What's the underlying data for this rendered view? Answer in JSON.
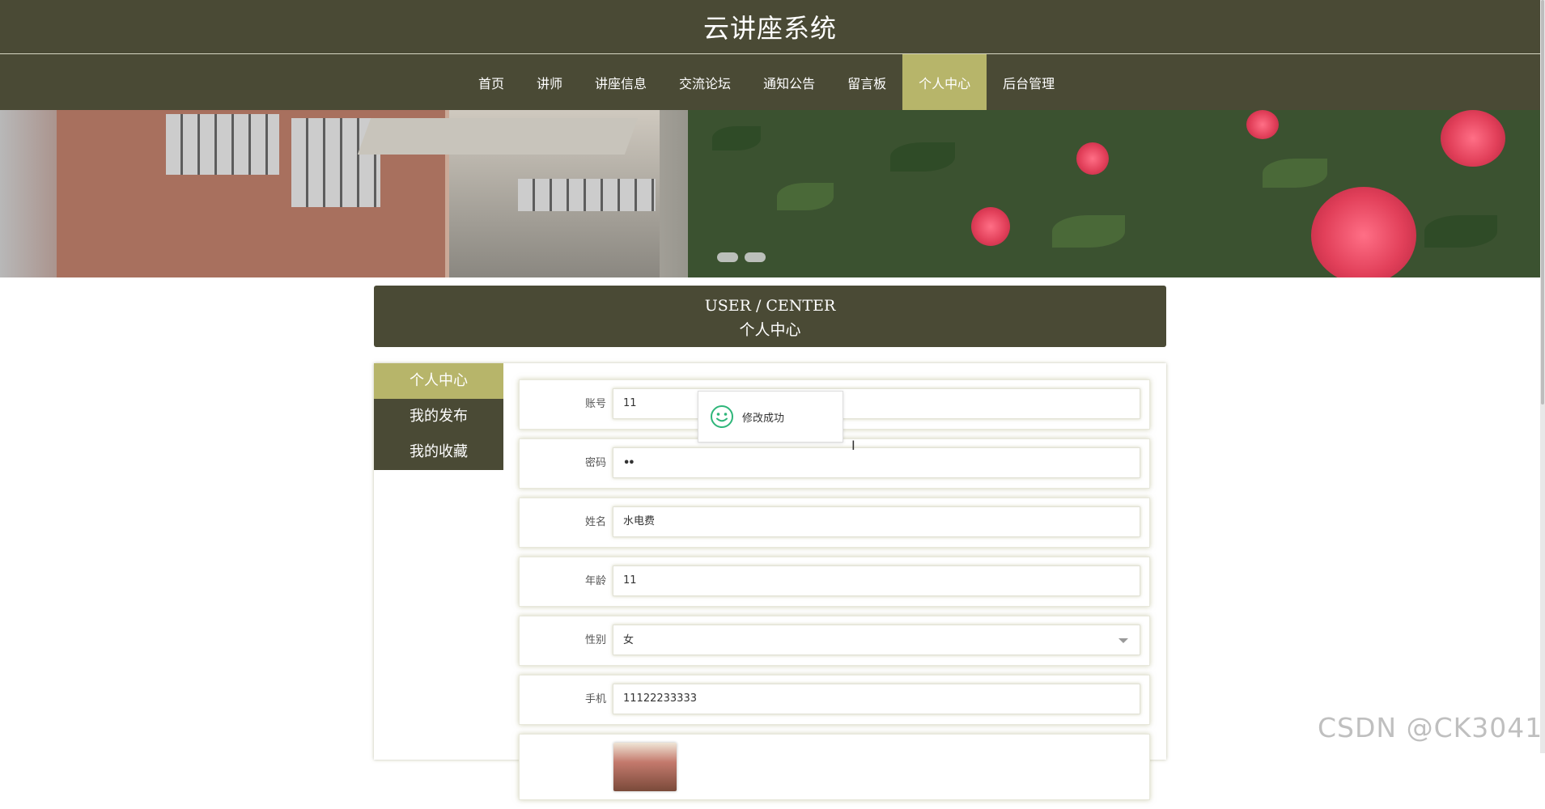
{
  "site": {
    "title": "云讲座系统"
  },
  "nav": {
    "items": [
      {
        "label": "首页",
        "active": false
      },
      {
        "label": "讲师",
        "active": false
      },
      {
        "label": "讲座信息",
        "active": false
      },
      {
        "label": "交流论坛",
        "active": false
      },
      {
        "label": "通知公告",
        "active": false
      },
      {
        "label": "留言板",
        "active": false
      },
      {
        "label": "个人中心",
        "active": true
      },
      {
        "label": "后台管理",
        "active": false
      }
    ]
  },
  "center_title": {
    "en": "USER / CENTER",
    "cn": "个人中心"
  },
  "sidebar": {
    "items": [
      {
        "label": "个人中心",
        "active": true
      },
      {
        "label": "我的发布",
        "active": false
      },
      {
        "label": "我的收藏",
        "active": false
      }
    ]
  },
  "form": {
    "account": {
      "label": "账号",
      "value": "11"
    },
    "password": {
      "label": "密码",
      "value": "••"
    },
    "name": {
      "label": "姓名",
      "value": "水电费"
    },
    "age": {
      "label": "年龄",
      "value": "11"
    },
    "gender": {
      "label": "性别",
      "value": "女"
    },
    "phone": {
      "label": "手机",
      "value": "11122233333"
    }
  },
  "toast": {
    "message": "修改成功",
    "icon": "smile-icon"
  },
  "watermark": "CSDN @CK3041",
  "colors": {
    "header": "#4a4a35",
    "accent": "#b7b56a",
    "toast_icon": "#2fb67a"
  }
}
